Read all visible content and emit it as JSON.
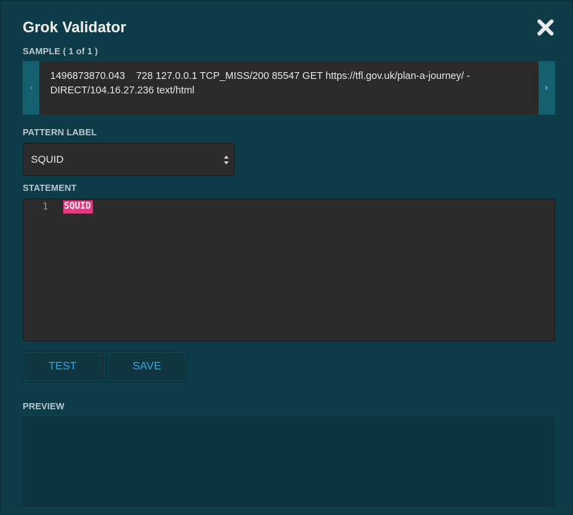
{
  "dialog": {
    "title": "Grok Validator"
  },
  "sample": {
    "label": "SAMPLE ( 1 of 1 )",
    "text": "1496873870.043    728 127.0.0.1 TCP_MISS/200 85547 GET https://tfl.gov.uk/plan-a-journey/ - DIRECT/104.16.27.236 text/html"
  },
  "pattern": {
    "label": "PATTERN LABEL",
    "selected": "SQUID"
  },
  "statement": {
    "label": "STATEMENT",
    "line_number": "1",
    "code": "SQUID"
  },
  "buttons": {
    "test_label": "TEST",
    "save_label": "SAVE"
  },
  "preview": {
    "label": "PREVIEW"
  },
  "icons": {
    "close": "close-icon",
    "prev": "chevron-left-icon",
    "next": "chevron-right-icon",
    "select": "select-caret-icon"
  },
  "colors": {
    "panel_bg": "#0d3b47",
    "accent_blue": "#35a7e8",
    "highlight_pink": "#e23a7e"
  }
}
